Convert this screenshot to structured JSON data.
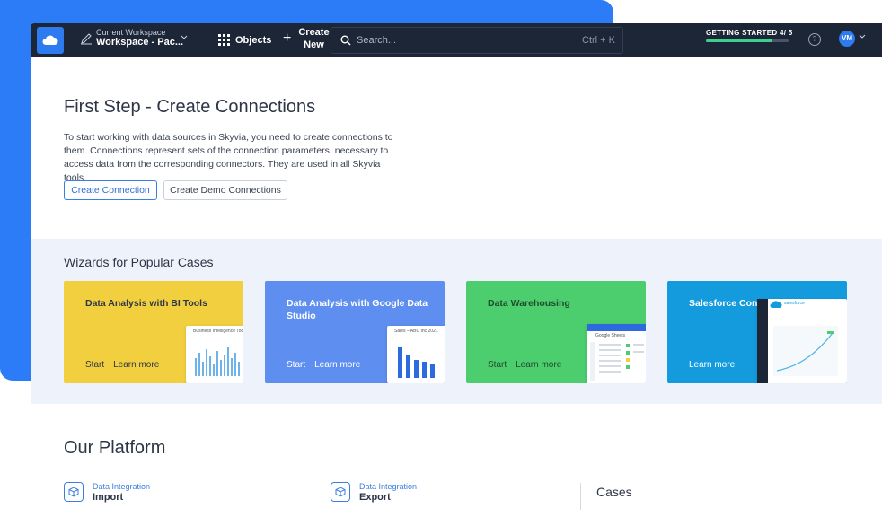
{
  "topbar": {
    "workspace_caption": "Current Workspace",
    "workspace_name": "Workspace - Pac...",
    "objects_label": "Objects",
    "create_line1": "Create",
    "create_line2": "New",
    "search_placeholder": "Search...",
    "search_shortcut": "Ctrl + K",
    "getting_started": "GETTING STARTED 4/ 5",
    "getting_started_progress": 0.8,
    "help_icon": "question-circle-icon",
    "help_glyph": "?",
    "avatar_initials": "VM"
  },
  "first_step": {
    "title": "First Step - Create Connections",
    "description": "To start working with data sources in Skyvia, you need to create connections to them. Connections represent sets of the connection parameters, necessary to access data from the corresponding connectors. They are used in all Skyvia tools.",
    "primary_button": "Create Connection",
    "secondary_button": "Create Demo Connections"
  },
  "wizards": {
    "title": "Wizards for Popular Cases",
    "cards": [
      {
        "title": "Data Analysis with BI Tools",
        "start": "Start",
        "learn": "Learn more",
        "color": "#f2cf3f",
        "text_color": "#2d3646",
        "mock_title": "Business Intelligence Tool"
      },
      {
        "title": "Data Analysis with Google Data Studio",
        "start": "Start",
        "learn": "Learn more",
        "color": "#5e8ef0",
        "text_color": "#ffffff",
        "mock_title": "Sales – ABC Inc 2021"
      },
      {
        "title": "Data Warehousing",
        "start": "Start",
        "learn": "Learn more",
        "color": "#4ccd6e",
        "text_color": "#1f4d2c",
        "mock_title": "Google Sheets"
      },
      {
        "title": "Salesforce Connect",
        "learn": "Learn more",
        "color": "#139bde",
        "text_color": "#ffffff",
        "mock_title": "salesforce"
      }
    ]
  },
  "platform": {
    "title": "Our Platform",
    "items": [
      {
        "caption": "Data Integration",
        "name": "Import"
      },
      {
        "caption": "Data Integration",
        "name": "Export"
      }
    ],
    "cases": "Cases"
  }
}
